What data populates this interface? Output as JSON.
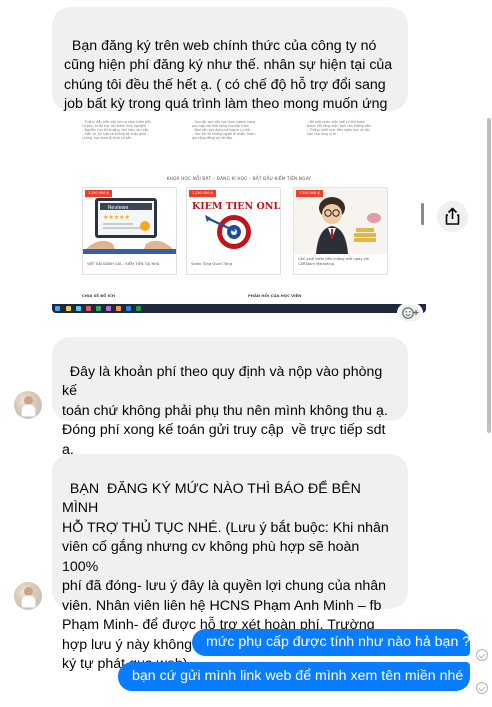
{
  "messages": [
    {
      "id": "m1",
      "direction": "incoming",
      "text": "Bạn đăng ký trên web chính thức của công ty nó\ncũng hiện phí đăng ký như thế. nhân sự hiện tại của\nchúng tôi đều thế hết ạ. ( có chế độ hỗ trợ đổi sang\njob bất kỳ trong quá trình làm theo mong muốn ứng\nviên mà không đóng lại phí)"
    },
    {
      "id": "m2",
      "direction": "incoming",
      "type": "image",
      "screenshot": {
        "heading": "KHOÁ HỌC NỔI BẬT – ĐĂNG KÍ HỌC – BẮT ĐẦU KIẾM TIỀN NGAY",
        "top_left_text": "– Thời kì đầu tiên nên tìm ra cách kiếm tiền\ncơ bản, từ đó học hỏi thêm kinh nghiệm\n– Nghiên cứu thị trường, tìm hiểu nhu cầu\n– Kiên trì, kỷ luật và không bỏ cuộc giữa\nchừng, học theo lộ trình có sẵn",
        "top_mid_text": "– Sau đó, bạn cần lựa chọn ngành hàng\nphù hợp với khả năng của bản thân\n– Bạn cần xây dựng kế hoạch cụ thể\n– Học hỏi từ những người đi trước, tham\ngia cộng đồng và hỏi đáp",
        "top_right_text": "– Để một nhân viên mới có thể hoàn\nthành tốt công việc, bạn cần hướng dẫn\n– Thống nhất mục tiêu ngắn hạn và dài\nhạn cho từng vị trí",
        "cards": [
          {
            "tag": "1.250.000 ₫",
            "caption": "VIẾT BÀI ĐÁNH GIÁ – KIẾM TIỀN TẠI NHÀ",
            "art": "reviews",
            "art_label": "Reviews"
          },
          {
            "tag": "1.250.000 ₫",
            "caption": "Video Tổng Quan Tăng",
            "art": "logo",
            "art_label": "KIEM TIEN ONLINE"
          },
          {
            "tag": "1.250.000 ₫",
            "caption": "CÁC phải kiếm tiền không mỗi ngày với CARStore Marketing",
            "art": "kid"
          }
        ],
        "section_left": "CHIA SẺ BỔ ÍCH",
        "section_right": "PHẢN HỒI CỦA HỌC VIÊN"
      }
    },
    {
      "id": "m3",
      "direction": "incoming",
      "text": "Đây là khoản phí theo quy định và nộp vào phòng kế\ntoán chứ không phải phụ thu nên mình không thu ạ.\nĐóng phí xong kế toán gửi truy cập  về trực tiếp sdt\nạ."
    },
    {
      "id": "m4",
      "direction": "incoming",
      "text": "BẠN  ĐĂNG KÝ MỨC NÀO THÌ BÁO ĐỂ BÊN MÌNH\nHỖ TRỢ THỦ TỤC NHÉ. (Lưu ý bắt buộc: Khi nhân\nviên cố gắng nhưng cv không phù hợp sẽ hoàn 100%\nphí đã đóng- lưu ý đây là quyền lợi chung của nhân\nviên. Nhân viên liên hệ HCNS Phạm Anh Minh – fb\nPhạm Minh- để được hỗ trợ xét hoàn phí. Trường\nhợp lưu ý này không áp dụng đối với Ứng viên đăng\nký tự phát qua web)"
    },
    {
      "id": "m5",
      "direction": "outgoing",
      "text": "mức phụ cấp được tính như nào hả bạn ?"
    },
    {
      "id": "m6",
      "direction": "outgoing",
      "text": "bạn cứ gửi mình link web để mình xem tên miền nhé"
    }
  ],
  "colors": {
    "incoming_bubble": "#f0f0f0",
    "outgoing_bubble": "#0a7cff",
    "outgoing_text": "#ffffff",
    "status_icon": "#b0b3b8"
  },
  "icons": {
    "share": "share-icon",
    "reaction": "add-reaction-icon",
    "sent": "sent-check-icon"
  }
}
